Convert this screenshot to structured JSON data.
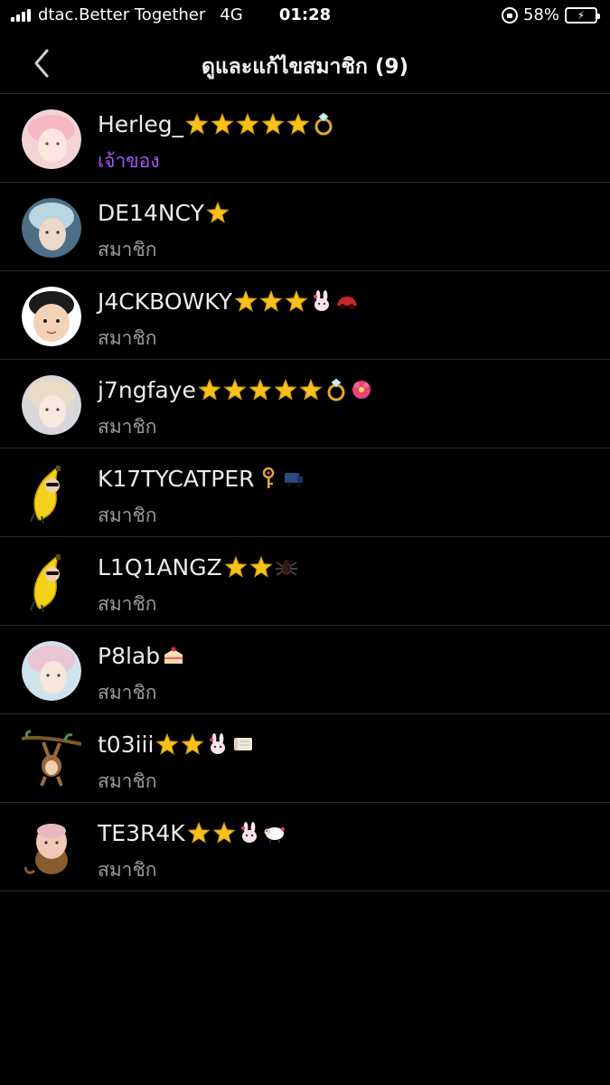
{
  "status_bar": {
    "carrier": "dtac.Better Together",
    "network": "4G",
    "time": "01:28",
    "battery_percent_label": "58%",
    "battery_level": 0.58
  },
  "nav": {
    "title": "ดูและแก้ไขสมาชิก (9)",
    "back_icon": "chevron-left-icon"
  },
  "members": [
    {
      "name": "Herleg_",
      "role": "เจ้าของ",
      "owner": true,
      "avatar": "face-pink",
      "badges": [
        "star",
        "star",
        "star",
        "star",
        "star",
        "ring"
      ]
    },
    {
      "name": "DE14NCY",
      "role": "สมาชิก",
      "owner": false,
      "avatar": "face-blue",
      "badges": [
        "star"
      ]
    },
    {
      "name": "J4CKBOWKY",
      "role": "สมาชิก",
      "owner": false,
      "avatar": "face-child",
      "badges": [
        "star",
        "star",
        "star",
        "rabbit",
        "car"
      ]
    },
    {
      "name": "j7ngfaye",
      "role": "สมาชิก",
      "owner": false,
      "avatar": "face-light",
      "badges": [
        "star",
        "star",
        "star",
        "star",
        "star",
        "ring",
        "hibiscus"
      ]
    },
    {
      "name": "K17TYCATPER",
      "role": "สมาชิก",
      "owner": false,
      "avatar": "banana",
      "badges": [
        "key",
        "truck"
      ]
    },
    {
      "name": "L1Q1ANGZ",
      "role": "สมาชิก",
      "owner": false,
      "avatar": "banana",
      "badges": [
        "star",
        "star",
        "spider"
      ]
    },
    {
      "name": "P8lab",
      "role": "สมาชิก",
      "owner": false,
      "avatar": "face-pastel",
      "badges": [
        "cake"
      ]
    },
    {
      "name": "t03iii",
      "role": "สมาชิก",
      "owner": false,
      "avatar": "monkey-branch",
      "badges": [
        "star",
        "star",
        "rabbit",
        "scroll"
      ]
    },
    {
      "name": "TE3R4K",
      "role": "สมาชิก",
      "owner": false,
      "avatar": "monkey",
      "badges": [
        "star",
        "star",
        "rabbit",
        "sheep"
      ]
    }
  ],
  "colors": {
    "background": "#000000",
    "owner_role": "#a855f7",
    "member_role": "#9a9a9a",
    "divider": "#2a2a2a",
    "star": "#f7c21a"
  }
}
